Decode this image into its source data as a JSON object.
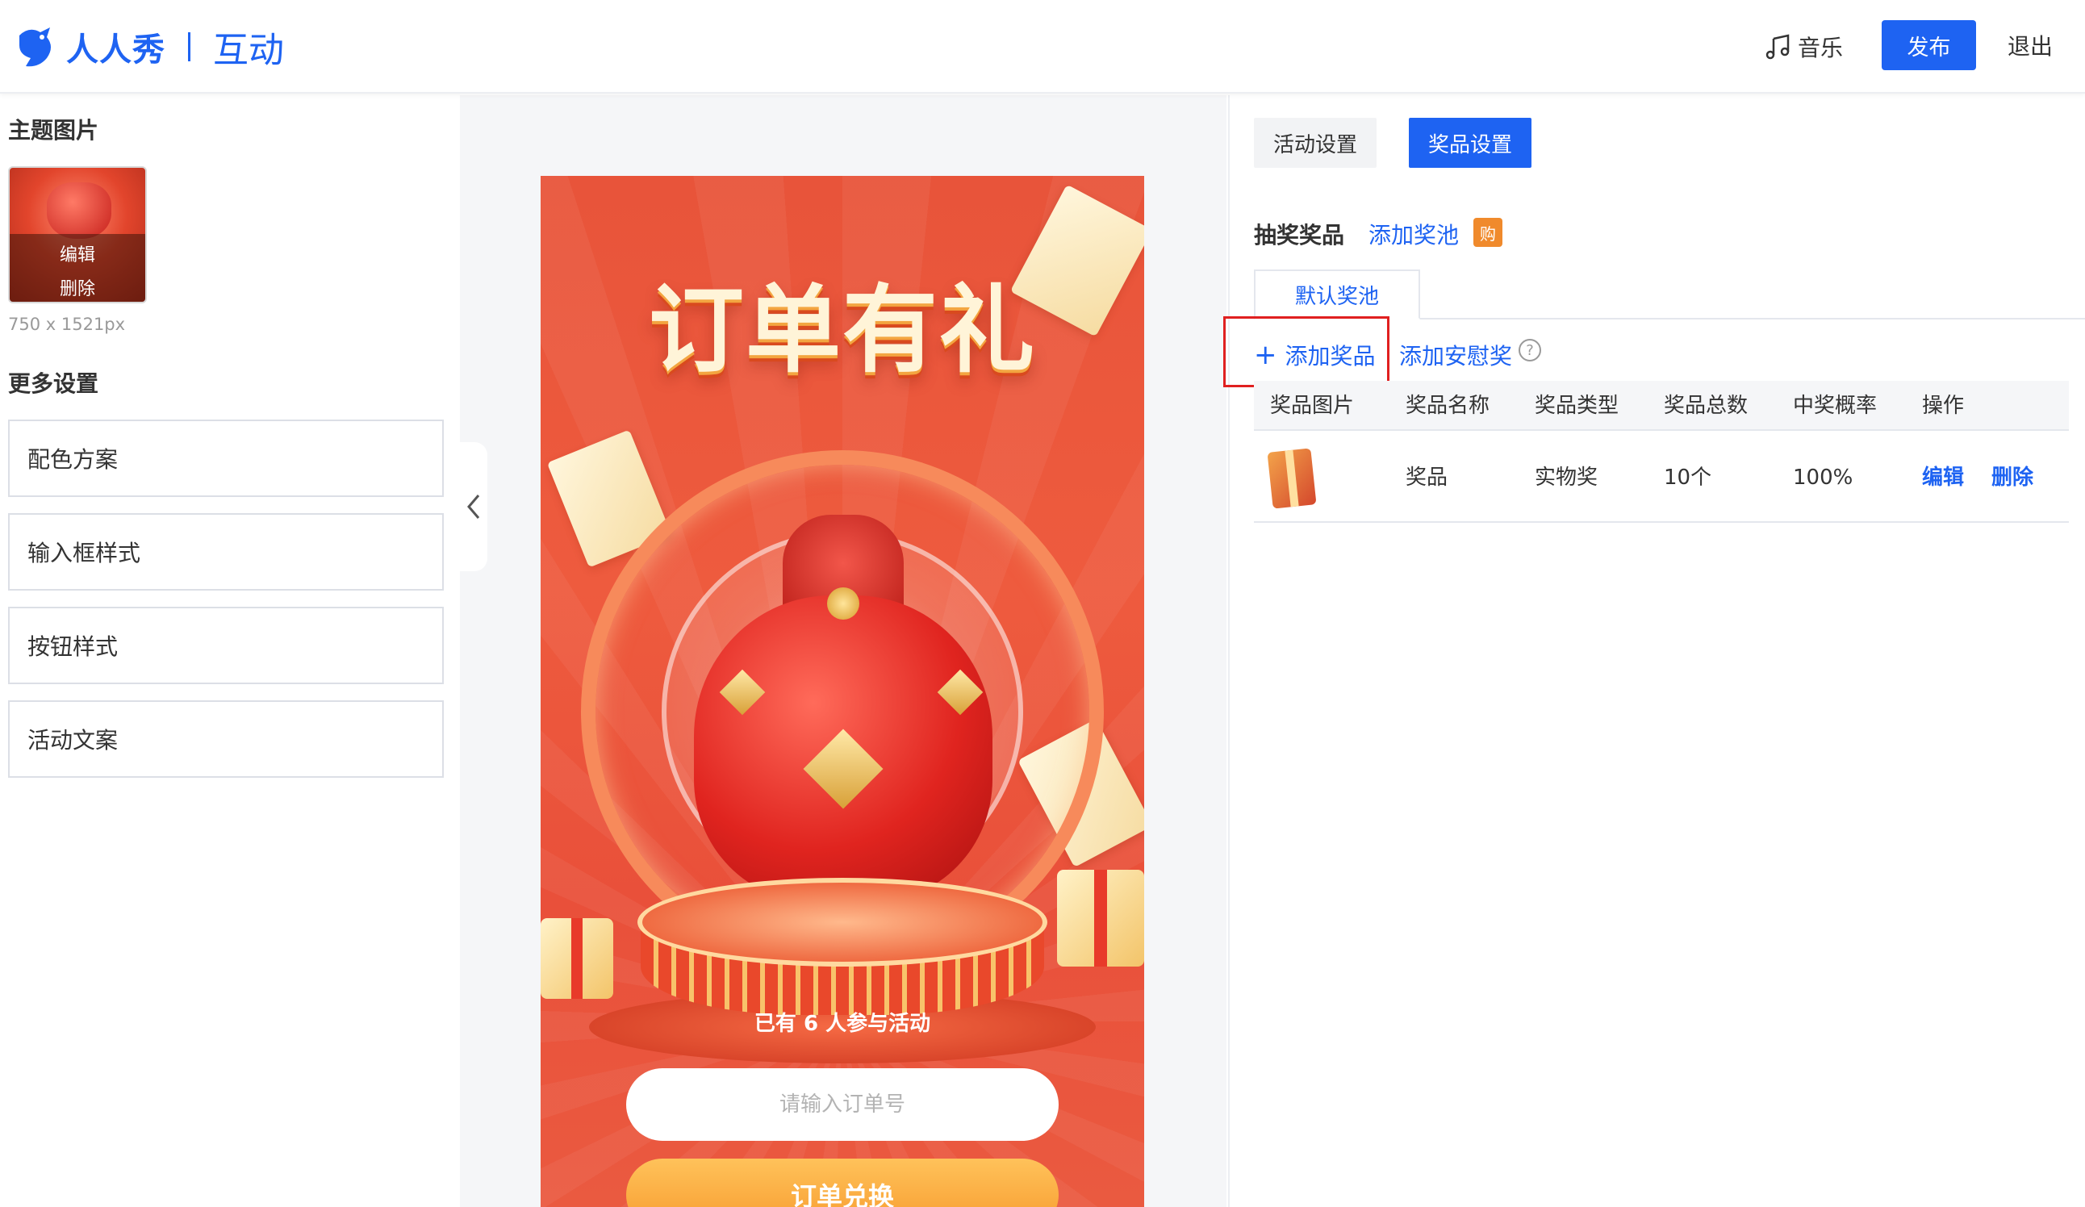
{
  "header": {
    "logo_text": "人人秀",
    "logo_sub": "互动",
    "music_label": "音乐",
    "publish_label": "发布",
    "exit_label": "退出"
  },
  "left": {
    "theme_title": "主题图片",
    "thumb_edit": "编辑",
    "thumb_delete": "删除",
    "thumb_size": "750 x 1521px",
    "more_title": "更多设置",
    "settings": [
      {
        "label": "配色方案"
      },
      {
        "label": "输入框样式"
      },
      {
        "label": "按钮样式"
      },
      {
        "label": "活动文案"
      }
    ]
  },
  "preview": {
    "title": "订单有礼",
    "participants": "已有 6 人参与活动",
    "input_placeholder": "请输入订单号",
    "button_label": "订单兑换"
  },
  "right": {
    "tabs": [
      {
        "label": "活动设置",
        "active": false
      },
      {
        "label": "奖品设置",
        "active": true
      }
    ],
    "lottery_label": "抽奖奖品",
    "add_pool": "添加奖池",
    "buy_badge": "购",
    "pool_tab": "默认奖池",
    "add_prize": "添加奖品",
    "add_consolation": "添加安慰奖",
    "help_glyph": "?",
    "columns": [
      "奖品图片",
      "奖品名称",
      "奖品类型",
      "奖品总数",
      "中奖概率",
      "操作"
    ],
    "rows": [
      {
        "name": "奖品",
        "type": "实物奖",
        "total": "10个",
        "probability": "100%",
        "edit": "编辑",
        "delete": "删除"
      }
    ]
  },
  "colors": {
    "accent": "#1e63f2",
    "highlight_box": "#e02020",
    "badge": "#f08a2c"
  }
}
